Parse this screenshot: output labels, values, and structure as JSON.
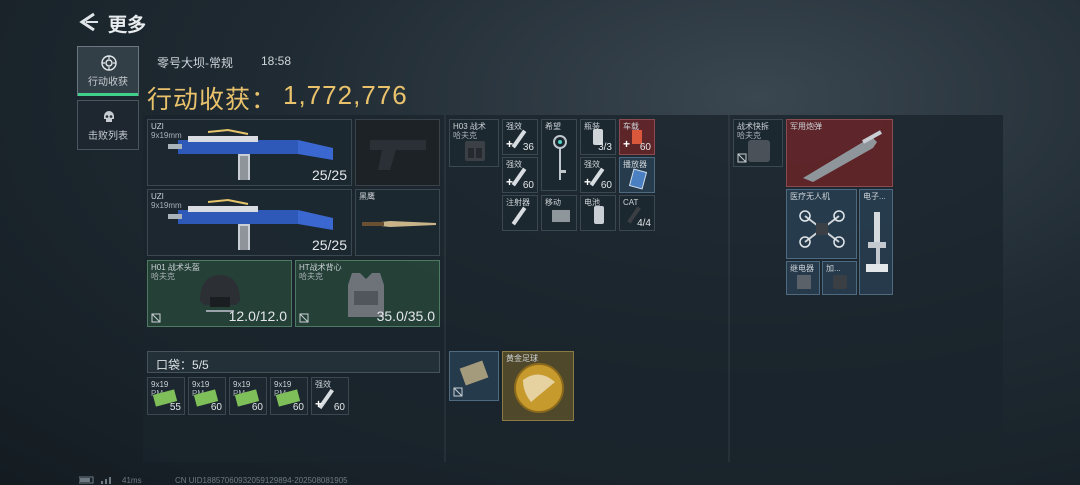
{
  "header": {
    "title": "更多"
  },
  "tabs": [
    {
      "label": "行动收获",
      "icon": "target-icon",
      "active": true
    },
    {
      "label": "击败列表",
      "icon": "skull-icon",
      "active": false
    }
  ],
  "match": {
    "map": "零号大坝-常规",
    "time": "18:58"
  },
  "earnings": {
    "label": "行动收获：",
    "value": "1,772,776"
  },
  "equipment": {
    "weapon1": {
      "name": "UZI",
      "sub": "9x19mm",
      "ammo": "25/25"
    },
    "weapon2": {
      "name": "UZI",
      "sub": "9x19mm",
      "ammo": "25/25"
    },
    "knife": {
      "name": "黑鹰"
    },
    "helmet": {
      "name": "H01 战术头盔",
      "sub": "哈夫克",
      "durability": "12.0/12.0"
    },
    "armor": {
      "name": "HT战术背心",
      "sub": "哈夫克",
      "durability": "35.0/35.0"
    }
  },
  "pocket": {
    "label": "口袋：",
    "count": "5/5",
    "items": [
      {
        "name": "9x19",
        "sub": "PM",
        "count": "55"
      },
      {
        "name": "9x19",
        "sub": "PM",
        "count": "60"
      },
      {
        "name": "9x19",
        "sub": "PM",
        "count": "60"
      },
      {
        "name": "9x19",
        "sub": "PM",
        "count": "60"
      },
      {
        "name": "强效",
        "count": "60"
      }
    ]
  },
  "backpack": {
    "rig": {
      "name": "H03 战术",
      "sub": "哈夫克"
    },
    "items": [
      {
        "name": "强效",
        "count": "36"
      },
      {
        "name": "希望",
        "count": ""
      },
      {
        "name": "瓶装",
        "count": "3/3"
      },
      {
        "name": "车载",
        "count": "60"
      },
      {
        "name": "强效",
        "count": "60"
      },
      {
        "name": "强效",
        "count": "60"
      },
      {
        "name": "播放器",
        "count": ""
      },
      {
        "name": "注射器",
        "count": ""
      },
      {
        "name": "移动",
        "count": ""
      },
      {
        "name": "电池",
        "count": ""
      },
      {
        "name": "CAT",
        "count": "4/4"
      }
    ],
    "lower": [
      {
        "name": "",
        "count": ""
      },
      {
        "name": "黄金足球",
        "count": ""
      }
    ]
  },
  "safebox": {
    "case": {
      "name": "战术快拆",
      "sub": "哈夫克"
    },
    "items": [
      {
        "name": "军用炮弹"
      },
      {
        "name": "医疗无人机"
      },
      {
        "name": "电子..."
      },
      {
        "name": "继电器"
      },
      {
        "name": "加..."
      }
    ]
  },
  "footer": {
    "ping": "41ms",
    "uid": "CN UID18857060932059129894-202508081905"
  },
  "colors": {
    "accent": "#e9c26b",
    "active_tab": "#3fd08b"
  }
}
